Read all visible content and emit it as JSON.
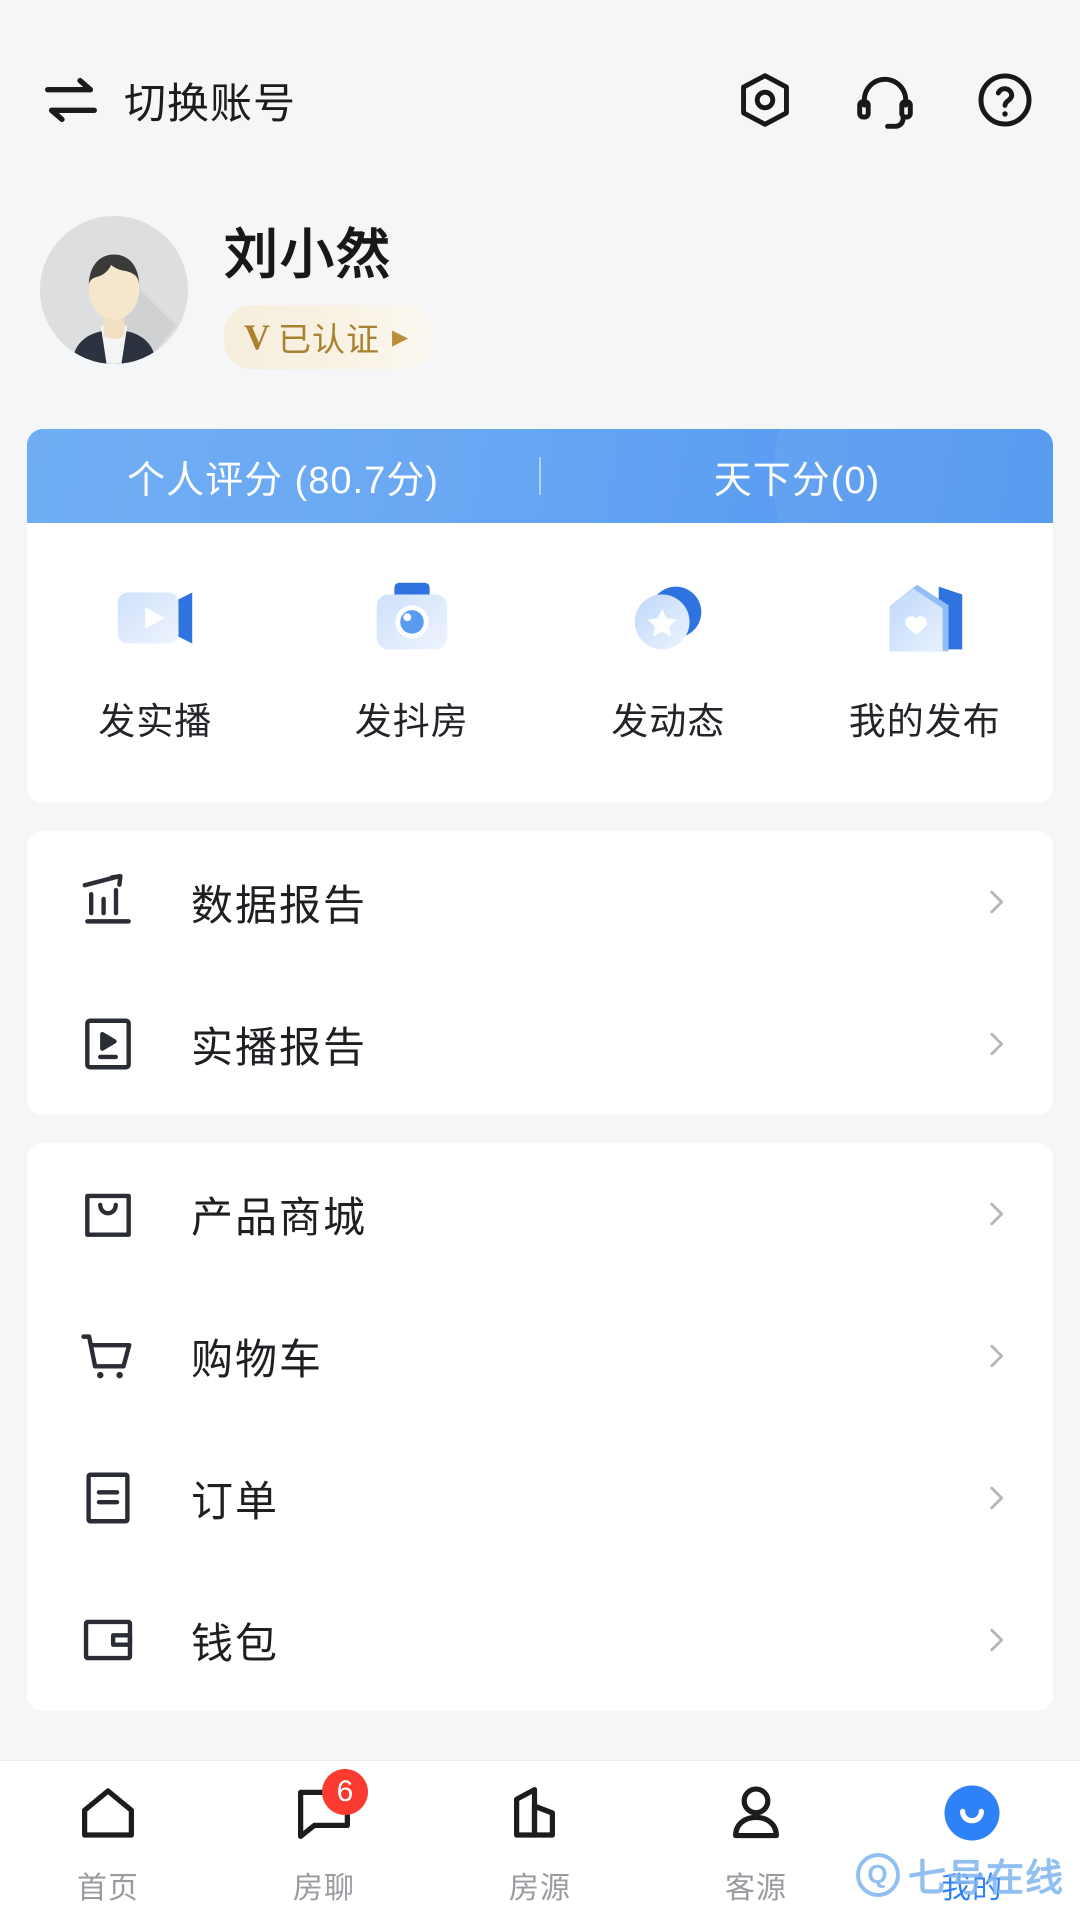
{
  "header": {
    "switch_account_label": "切换账号",
    "switch_icon": "swap-arrows-icon",
    "icons": [
      {
        "name": "settings-nut-icon"
      },
      {
        "name": "headset-support-icon"
      },
      {
        "name": "help-question-icon"
      }
    ]
  },
  "profile": {
    "avatar": "default-user-avatar",
    "username": "刘小然",
    "verify_v": "V",
    "verify_label": "已认证",
    "verify_arrow": "▶"
  },
  "score_banner": {
    "tabs": [
      {
        "label": "个人评分 (80.7分)"
      },
      {
        "label": "天下分(0)"
      }
    ]
  },
  "quick_actions": [
    {
      "label": "发实播",
      "icon": "live-video-icon"
    },
    {
      "label": "发抖房",
      "icon": "camera-icon"
    },
    {
      "label": "发动态",
      "icon": "star-circle-icon"
    },
    {
      "label": "我的发布",
      "icon": "house-heart-icon"
    }
  ],
  "menu_groups": [
    {
      "rows": [
        {
          "label": "数据报告",
          "icon": "bar-chart-trend-icon"
        },
        {
          "label": "实播报告",
          "icon": "play-square-icon"
        }
      ]
    },
    {
      "rows": [
        {
          "label": "产品商城",
          "icon": "shopping-bag-icon"
        },
        {
          "label": "购物车",
          "icon": "shopping-cart-icon"
        },
        {
          "label": "订单",
          "icon": "order-list-icon"
        },
        {
          "label": "钱包",
          "icon": "wallet-icon"
        }
      ]
    }
  ],
  "tabbar": [
    {
      "label": "首页",
      "icon": "home-icon",
      "badge": null,
      "active": false
    },
    {
      "label": "房聊",
      "icon": "chat-bubble-icon",
      "badge": "6",
      "active": false
    },
    {
      "label": "房源",
      "icon": "buildings-icon",
      "badge": null,
      "active": false
    },
    {
      "label": "客源",
      "icon": "person-icon",
      "badge": null,
      "active": false
    },
    {
      "label": "我的",
      "icon": "smiley-avatar-icon",
      "badge": null,
      "active": true
    }
  ],
  "watermark": {
    "q": "Q",
    "text": "七号在线"
  },
  "colors": {
    "accent_blue": "#2f81f7",
    "banner_blue": "#6aa8f3",
    "badge_red": "#fb3b30",
    "verify_gold": "#a9822f",
    "page_bg": "#f5f6f8"
  }
}
